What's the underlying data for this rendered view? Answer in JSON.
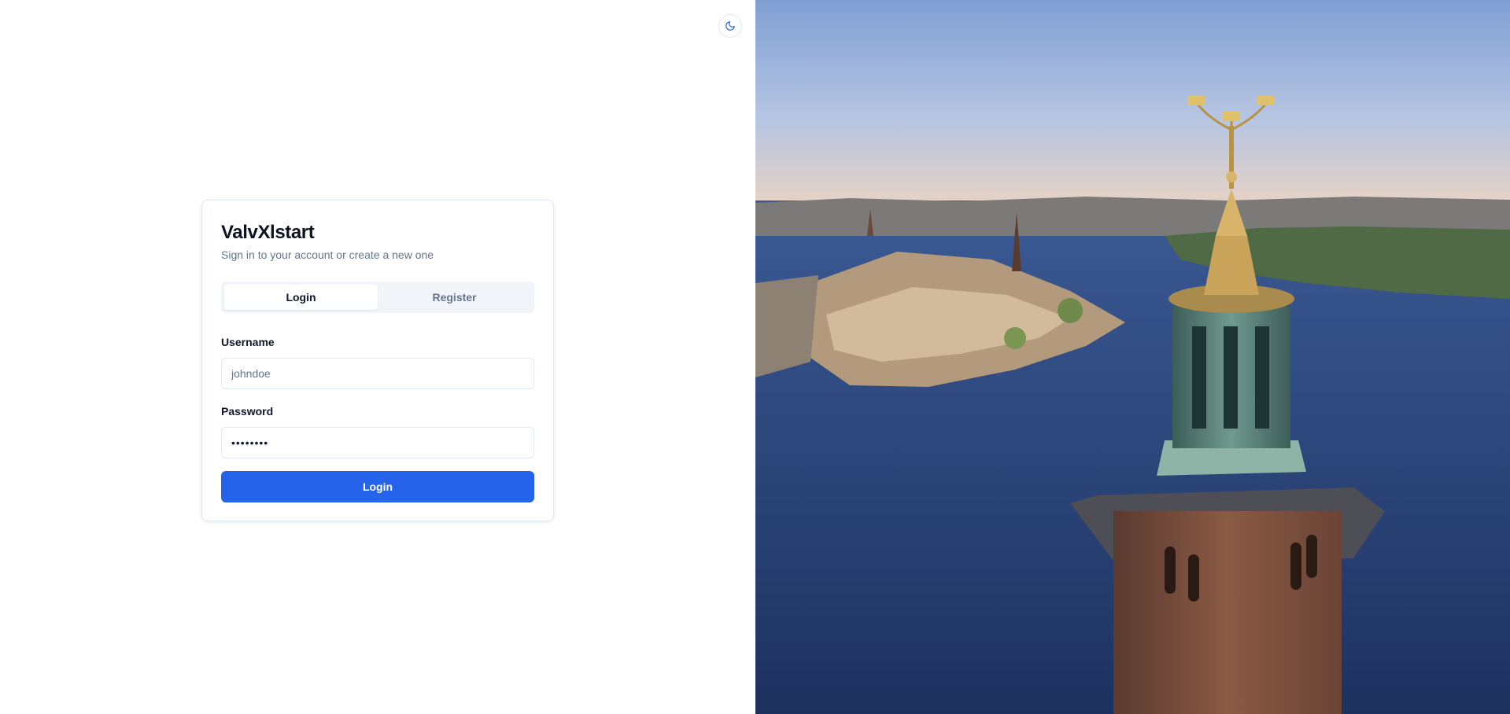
{
  "app": {
    "title": "ValvXlstart",
    "subtitle": "Sign in to your account or create a new one"
  },
  "tabs": [
    {
      "label": "Login",
      "active": true
    },
    {
      "label": "Register",
      "active": false
    }
  ],
  "form": {
    "username_label": "Username",
    "username_placeholder": "johndoe",
    "username_value": "",
    "password_label": "Password",
    "password_value": "••••••••",
    "submit_label": "Login"
  },
  "theme_toggle": {
    "icon": "moon-icon"
  },
  "hero_image": {
    "icon": "city-hall-tower-photo"
  },
  "colors": {
    "primary": "#2563eb",
    "muted_text": "#64748b",
    "border": "#e2e8f0",
    "tab_bg": "#f1f5f9"
  }
}
